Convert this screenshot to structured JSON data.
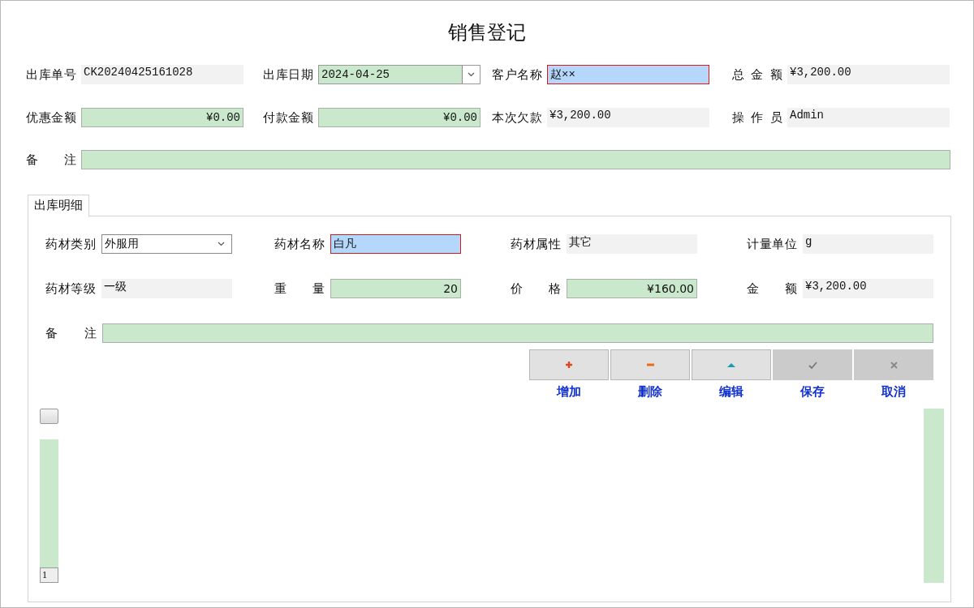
{
  "title": "销售登记",
  "header_fields": [
    {
      "label": "出库单号",
      "value": "CK20240425161028",
      "kind": "readonly",
      "focused": false
    },
    {
      "label": "出库日期",
      "value": "2024-04-25",
      "kind": "date",
      "focused": false
    },
    {
      "label": "客户名称",
      "value": "赵××",
      "kind": "text",
      "focused": true
    },
    {
      "label": "总 金 额",
      "value": "¥3,200.00",
      "kind": "readonly",
      "focused": false
    },
    {
      "label": "优惠金额",
      "value": "¥0.00",
      "kind": "number",
      "focused": false
    },
    {
      "label": "付款金额",
      "value": "¥0.00",
      "kind": "number",
      "focused": false
    },
    {
      "label": "本次欠款",
      "value": "¥3,200.00",
      "kind": "readonly",
      "focused": false
    },
    {
      "label": "操 作 员",
      "value": "Admin",
      "kind": "readonly",
      "focused": false
    }
  ],
  "note": {
    "label": "备 注",
    "kind": "text",
    "focused": false
  },
  "tabs": [
    {
      "label": "出库明细",
      "selected": true
    }
  ],
  "detail_fields": [
    {
      "label": "药材类别",
      "value": "外服用",
      "kind": "combo",
      "focused": false
    },
    {
      "label": "药材名称",
      "value": "白凡",
      "kind": "text",
      "focused": true
    },
    {
      "label": "药材属性",
      "value": "其它",
      "kind": "readonly",
      "focused": false
    },
    {
      "label": "计量单位",
      "value": "g",
      "kind": "readonly",
      "focused": false
    },
    {
      "label": "药材等级",
      "value": "一级",
      "kind": "readonly",
      "focused": false
    },
    {
      "label": "重 量",
      "value": "20",
      "kind": "number",
      "focused": false
    },
    {
      "label": "价 格",
      "value": "¥160.00",
      "kind": "number",
      "focused": false
    },
    {
      "label": "金 额",
      "value": "¥3,200.00",
      "kind": "readonly",
      "focused": false
    }
  ],
  "detail_note": {
    "label": "备 注",
    "kind": "text",
    "focused": false
  },
  "buttons": [
    {
      "kind": "add",
      "label": "增加",
      "disabled": false
    },
    {
      "kind": "delete",
      "label": "删除",
      "disabled": false
    },
    {
      "kind": "edit",
      "label": "编辑",
      "disabled": false
    },
    {
      "kind": "save",
      "label": "保存",
      "disabled": true
    },
    {
      "kind": "cancel",
      "label": "取消",
      "disabled": true
    }
  ],
  "grid": {
    "row_header": "1"
  }
}
